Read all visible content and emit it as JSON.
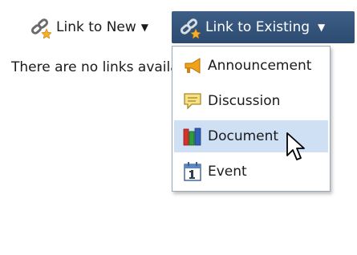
{
  "toolbar": {
    "link_new": {
      "label": "Link to New",
      "icon": "chain-link-new-icon"
    },
    "link_existing": {
      "label": "Link to Existing",
      "icon": "chain-link-existing-icon"
    },
    "active_color": "#3d5e86"
  },
  "content": {
    "empty_message": "There are no links available."
  },
  "menu": {
    "items": [
      {
        "label": "Announcement",
        "icon": "megaphone-icon"
      },
      {
        "label": "Discussion",
        "icon": "speech-bubble-icon"
      },
      {
        "label": "Document",
        "icon": "books-icon",
        "highlighted": true
      },
      {
        "label": "Event",
        "icon": "calendar-icon"
      }
    ],
    "highlight_color": "#cfe0f4"
  }
}
